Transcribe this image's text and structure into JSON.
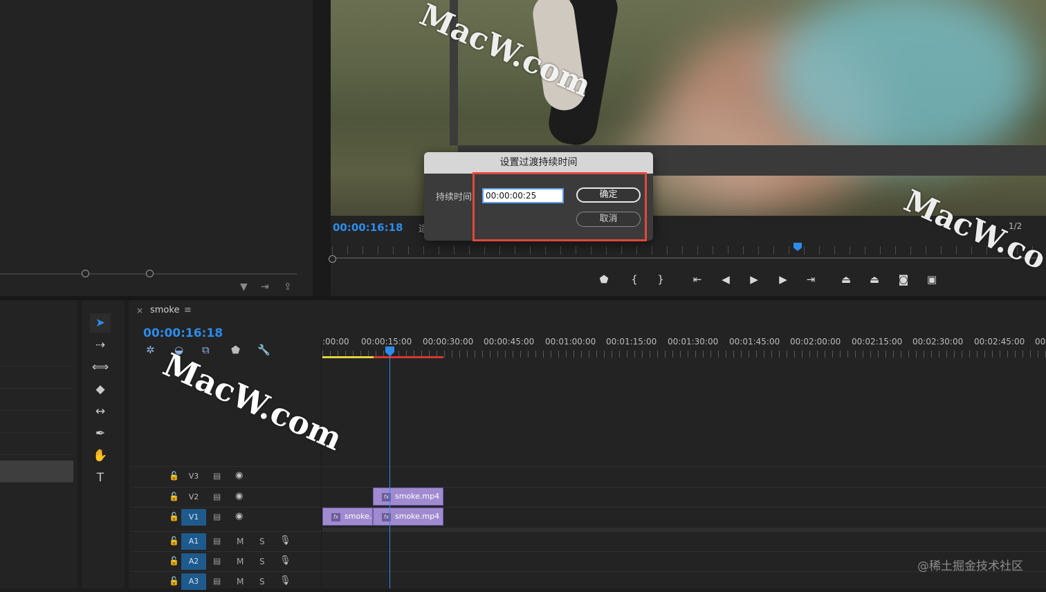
{
  "dialog": {
    "title": "设置过渡持续时间",
    "duration_label": "持续时间",
    "duration_value": "00:00:00:25",
    "ok_label": "确定",
    "cancel_label": "取消"
  },
  "program_monitor": {
    "timecode": "00:00:16:18",
    "fit_partial": "适",
    "page_indicator": "1/2"
  },
  "sequence": {
    "close_icon": "×",
    "name": "smoke",
    "menu_icon": "≡",
    "timecode": "00:00:16:18"
  },
  "ruler": {
    "labels": [
      ":00:00",
      "00:00:15:00",
      "00:00:30:00",
      "00:00:45:00",
      "00:01:00:00",
      "00:01:15:00",
      "00:01:30:00",
      "00:01:45:00",
      "00:02:00:00",
      "00:02:15:00",
      "00:02:30:00",
      "00:02:45:00",
      "00"
    ]
  },
  "tracks": {
    "video": [
      {
        "name": "V3",
        "targeted": false
      },
      {
        "name": "V2",
        "targeted": false
      },
      {
        "name": "V1",
        "targeted": true
      }
    ],
    "audio": [
      {
        "name": "A1",
        "m": "M",
        "s": "S",
        "targeted": true
      },
      {
        "name": "A2",
        "m": "M",
        "s": "S",
        "targeted": true
      },
      {
        "name": "A3",
        "m": "M",
        "s": "S",
        "targeted": true
      }
    ]
  },
  "clips": {
    "v2_clip": "smoke.mp4",
    "v1_clip_a": "smoke.",
    "v1_clip_b": "smoke.mp4",
    "fx_badge": "fx"
  },
  "watermarks": {
    "top": "MacW.com",
    "right": "MacW.co",
    "middle": "MacW.com"
  },
  "credit": "@稀土掘金技术社区",
  "icons": {
    "select_tool": "selection-arrow-icon",
    "track_select": "track-select-forward-icon",
    "ripple": "ripple-edit-icon",
    "razor": "razor-icon",
    "slip": "slip-icon",
    "pen": "pen-icon",
    "hand": "hand-icon",
    "type": "type-icon"
  },
  "colors": {
    "accent_blue": "#2d8ceb",
    "highlight_red": "#e2473c",
    "clip_purple": "#a08bd0",
    "render_yellow": "#e4d33b",
    "render_red": "#d9362f"
  }
}
